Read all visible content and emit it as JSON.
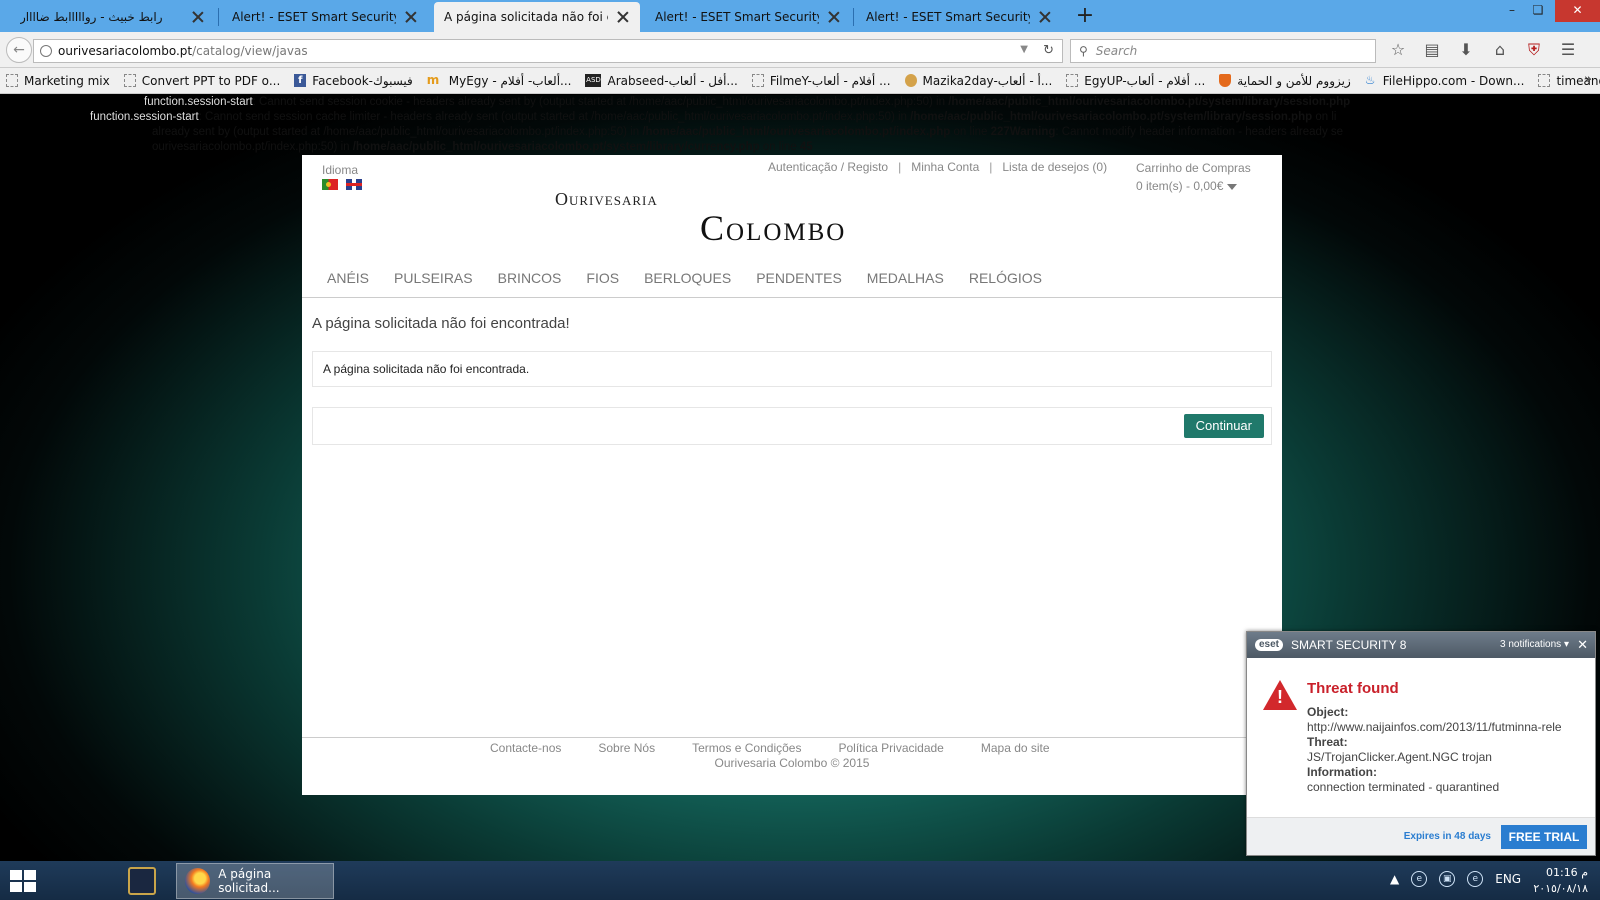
{
  "browser": {
    "tabs": [
      {
        "title": "رابط خبيث - روااااابط ضاااار",
        "active": false
      },
      {
        "title": "Alert! - ESET Smart Security",
        "active": false
      },
      {
        "title": "A página solicitada não foi en...",
        "active": true
      },
      {
        "title": "Alert! - ESET Smart Security",
        "active": false
      },
      {
        "title": "Alert! - ESET Smart Security",
        "active": false
      }
    ],
    "url_host": "ourivesariacolombo.pt",
    "url_path": "/catalog/view/javas",
    "search_placeholder": "Search",
    "bookmarks": [
      {
        "label": "Marketing mix",
        "icon": "blank"
      },
      {
        "label": "Convert PPT to PDF o...",
        "icon": "blank"
      },
      {
        "label": "Facebook-فيسبوك",
        "icon": "facebook"
      },
      {
        "label": "MyEgy - ألعاب- أفلام...",
        "icon": "myegy"
      },
      {
        "label": "Arabseed-أفل - ألعاب...",
        "icon": "asd"
      },
      {
        "label": "FilmeY-أفلام - ألعاب ...",
        "icon": "blank"
      },
      {
        "label": "Mazika2day-أ - ألعاب...",
        "icon": "face"
      },
      {
        "label": "EgyUP-أفلام - ألعاب ...",
        "icon": "blank"
      },
      {
        "label": "زيزووم للأمن و الحماية",
        "icon": "shield"
      },
      {
        "label": "FileHippo.com - Down...",
        "icon": "hippo"
      },
      {
        "label": "timeanddate.com",
        "icon": "blank"
      }
    ],
    "bookmarks_more": "»",
    "accent": "#5aa8e8"
  },
  "php_errors": {
    "line1_label": "function.session-start",
    "line1_text": ": Cannot send session cookie - headers already sent by (output started at /home/aac/public_html/ourivesariacolombo.pt/index.php:50) in ",
    "line1_path": "/home/aac/public_html/ourivesariacolombo.pt/system/library/session.php",
    "line2_label": "function.session-start",
    "line2_text": ": Cannot send session cache limiter - headers already sent (output started at /home/aac/public_html/ourivesariacolombo.pt/index.php:50) in ",
    "line2_path": "/home/aac/public_html/ourivesariacolombo.pt/system/library/session.php",
    "line2_tail": " on li",
    "line3_text": "already sent by (output started at /home/aac/public_html/ourivesariacolombo.pt/index.php:50) in ",
    "line3_path": "/home/aac/public_html/ourivesariacolombo.pt/index.php",
    "line3_mid": " on line ",
    "line3_linenum": "227Warning",
    "line3_tail": ": Cannot modify header information - headers already se",
    "line4_text": "ourivesariacolombo.pt/index.php:50) in ",
    "line4_path": "/home/aac/public_html/ourivesariacolombo.pt/system/library/currency.php",
    "line4_mid": " on line ",
    "line4_linenum": "45"
  },
  "site": {
    "language_label": "Idioma",
    "top_links": [
      "Autenticação / Registo",
      "Minha Conta",
      "Lista de desejos (0)"
    ],
    "cart_title": "Carrinho de Compras",
    "cart_value": "0 item(s) - 0,00€",
    "logo_small": "Ourivesaria",
    "logo_big": "Colombo",
    "menu": [
      "ANÉIS",
      "PULSEIRAS",
      "BRINCOS",
      "FIOS",
      "BERLOQUES",
      "PENDENTES",
      "MEDALHAS",
      "RELÓGIOS"
    ],
    "heading": "A página solicitada não foi encontrada!",
    "message": "A página solicitada não foi encontrada.",
    "continue_label": "Continuar",
    "footer_links": [
      "Contacte-nos",
      "Sobre Nós",
      "Termos e Condições",
      "Política Privacidade",
      "Mapa do site"
    ],
    "copyright": "Ourivesaria Colombo © 2015",
    "button_color": "#20796b"
  },
  "eset": {
    "logo": "eset",
    "product": "SMART SECURITY 8",
    "notifications": "3 notifications",
    "title": "Threat found",
    "object_label": "Object:",
    "object_value": "http://www.naijainfos.com/2013/11/futminna-rele",
    "threat_label": "Threat:",
    "threat_value": "JS/TrojanClicker.Agent.NGC trojan",
    "info_label": "Information:",
    "info_value": "connection terminated - quarantined",
    "expires": "Expires in 48 days",
    "free_trial": "FREE TRIAL",
    "alert_color": "#c9202a",
    "link_color": "#2a7dd0"
  },
  "taskbar": {
    "firefox_label": "A página solicitad...",
    "language": "ENG",
    "time": "01:16 م",
    "date": "٢٠١٥/٠٨/١٨"
  }
}
